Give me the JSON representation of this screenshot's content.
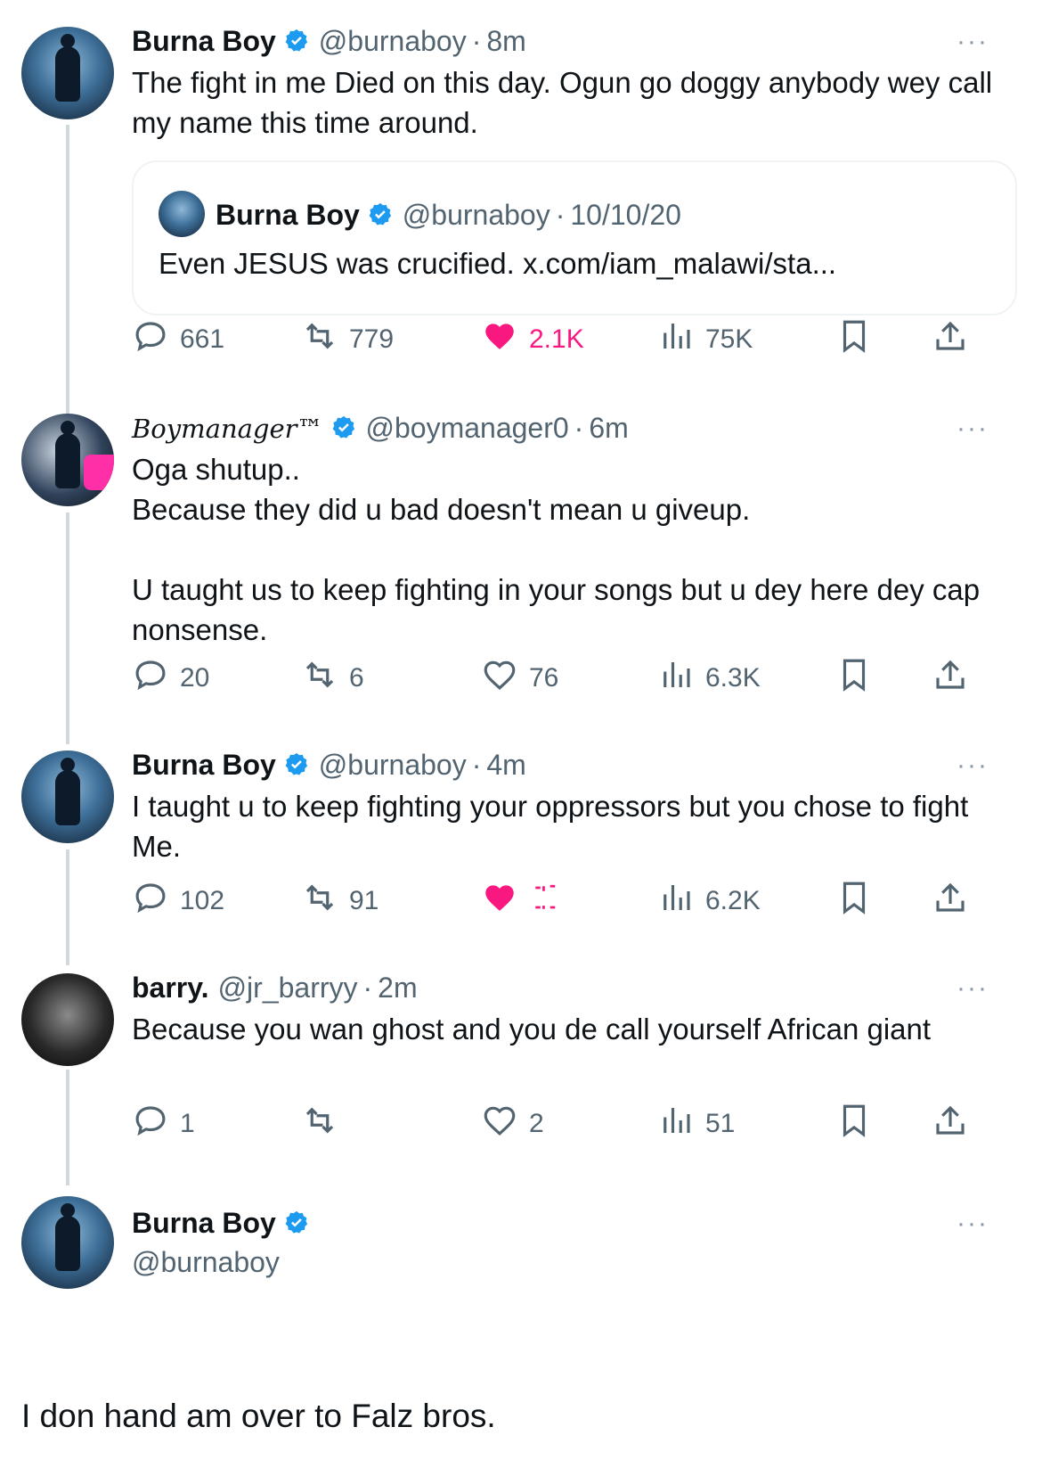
{
  "tweets": [
    {
      "name": "Burna Boy",
      "handle": "@burnaboy",
      "time": "8m",
      "text": "The fight in me Died on this day. Ogun go doggy anybody wey call my name this time around.",
      "quote": {
        "name": "Burna Boy",
        "handle": "@burnaboy",
        "date": "10/10/20",
        "text": "Even JESUS was crucified. x.com/iam_malawi/sta..."
      },
      "replies": "661",
      "retweets": "779",
      "likes": "2.1K",
      "views": "75K"
    },
    {
      "name": "Boymanager™",
      "handle": "@boymanager0",
      "time": "6m",
      "text": "Oga shutup..\nBecause they did u bad doesn't mean u giveup.\n\nU taught us to keep fighting in your songs but u dey here dey cap nonsense.",
      "replies": "20",
      "retweets": "6",
      "likes": "76",
      "views": "6.3K"
    },
    {
      "name": "Burna Boy",
      "handle": "@burnaboy",
      "time": "4m",
      "text": "I taught u to keep fighting your oppressors but you chose to fight Me.",
      "replies": "102",
      "retweets": "91",
      "likes": "",
      "views": "6.2K"
    },
    {
      "name": "barry.",
      "handle": "@jr_barryy",
      "time": "2m",
      "text": "Because you wan ghost and you de call yourself African giant",
      "replies": "1",
      "retweets": "",
      "likes": "2",
      "views": "51"
    },
    {
      "name": "Burna Boy",
      "handle": "@burnaboy",
      "text": "I don hand am over to Falz bros."
    }
  ],
  "more_glyph": "···",
  "separator": "·",
  "colors": {
    "verified": "#1d9bf0",
    "like": "#f91880",
    "muted": "#536471"
  }
}
